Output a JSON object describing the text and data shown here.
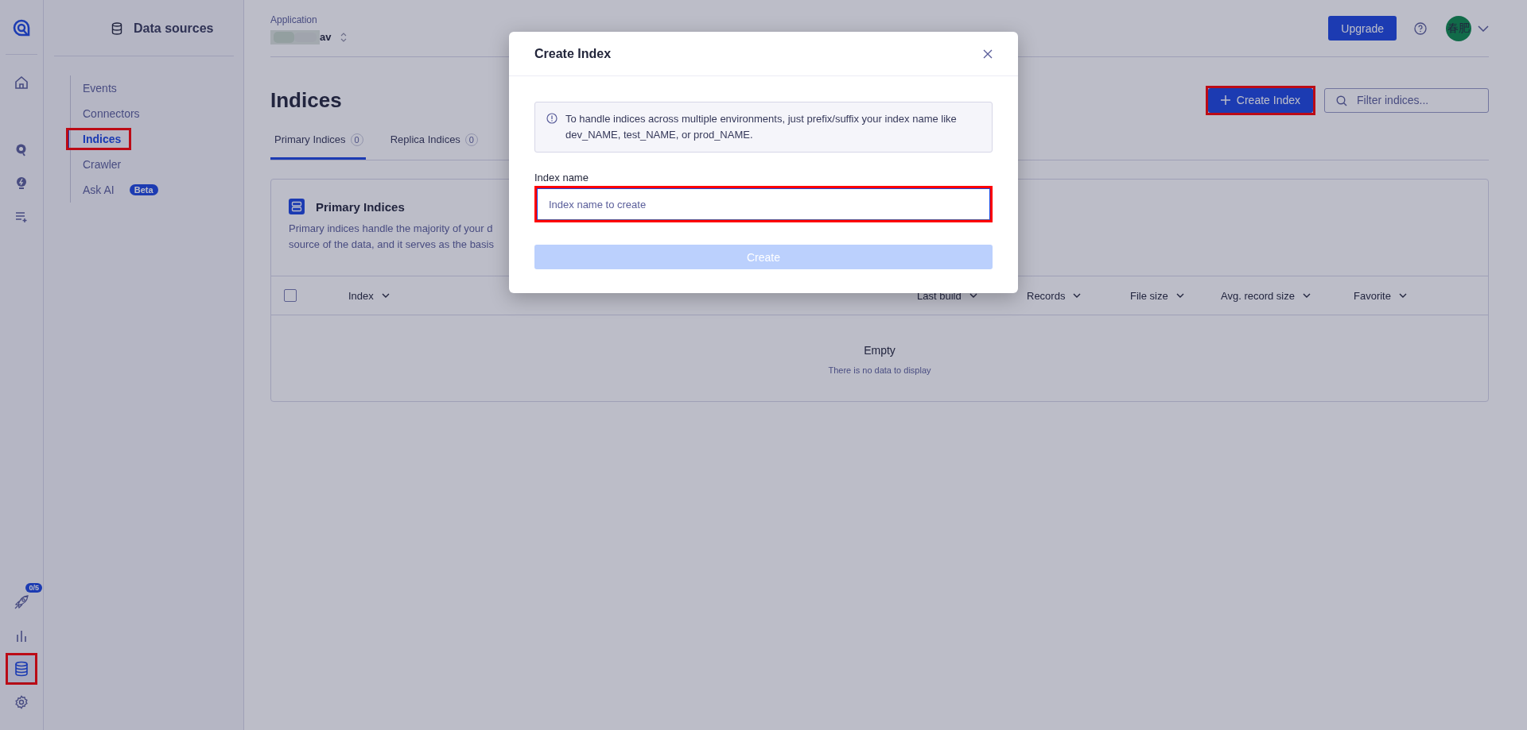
{
  "rail": {
    "top": [
      {
        "kind": "home",
        "selected": false,
        "highlighted": false
      },
      {
        "kind": "search",
        "selected": false,
        "highlighted": false
      },
      {
        "kind": "bulb",
        "selected": false,
        "highlighted": false
      },
      {
        "kind": "listplus",
        "selected": false,
        "highlighted": false
      }
    ],
    "bottom": [
      {
        "kind": "rocket",
        "badge": "0/5",
        "selected": false,
        "highlighted": false
      },
      {
        "kind": "chart",
        "selected": false,
        "highlighted": false
      },
      {
        "kind": "database",
        "selected": true,
        "highlighted": true
      },
      {
        "kind": "gear",
        "selected": false,
        "highlighted": false
      }
    ]
  },
  "sidebar": {
    "title": "Data sources",
    "items": [
      {
        "label": "Events",
        "selected": false,
        "highlighted": false
      },
      {
        "label": "Connectors",
        "selected": false,
        "highlighted": false
      },
      {
        "label": "Indices",
        "selected": true,
        "highlighted": true
      },
      {
        "label": "Crawler",
        "selected": false,
        "highlighted": false
      },
      {
        "label": "Ask AI",
        "badge": "Beta",
        "selected": false,
        "highlighted": false
      }
    ]
  },
  "header": {
    "application_label": "Application",
    "application_name": "av",
    "upgrade_button": "Upgrade",
    "avatar": "春肥"
  },
  "page": {
    "title": "Indices",
    "create_button": {
      "label": "Create Index",
      "highlighted": true
    },
    "filter": {
      "placeholder": "Filter indices..."
    },
    "tabs": [
      {
        "label": "Primary Indices",
        "count": "0",
        "selected": true
      },
      {
        "label": "Replica Indices",
        "count": "0",
        "selected": false
      }
    ]
  },
  "card": {
    "title": "Primary Indices",
    "description_lines": [
      "Primary indices handle the majority of your d",
      "source of the data, and it serves as the basis"
    ],
    "select_all": {
      "checked": false
    },
    "columns": [
      "Index",
      "Last build",
      "Records",
      "File size",
      "Avg. record size",
      "Favorite"
    ],
    "empty_title": "Empty",
    "empty_text": "There is no data to display"
  },
  "modal": {
    "title": "Create Index",
    "info": "To handle indices across multiple environments, just prefix/suffix your index name like dev_NAME, test_NAME, or prod_NAME.",
    "field_label": "Index name",
    "field": {
      "placeholder": "Index name to create",
      "highlighted": true
    },
    "submit": {
      "label": "Create",
      "disabled": true
    }
  }
}
